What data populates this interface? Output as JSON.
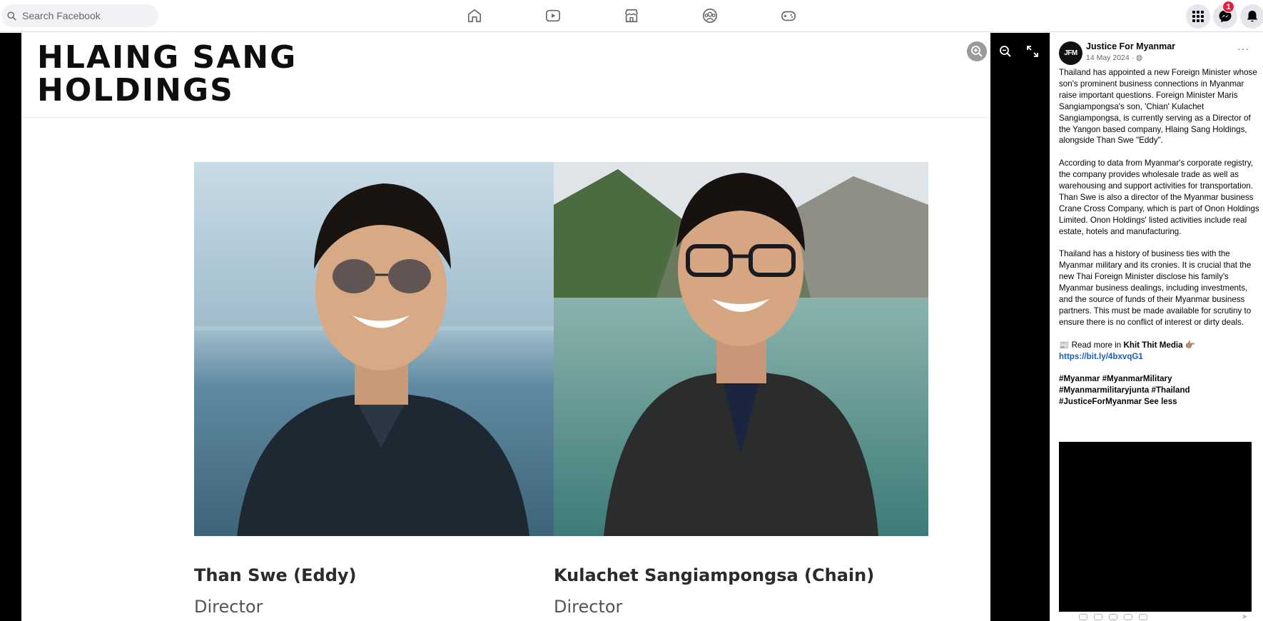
{
  "search": {
    "placeholder": "Search Facebook"
  },
  "nav": {
    "icons": [
      "home-icon",
      "video-icon",
      "marketplace-icon",
      "groups-icon",
      "gaming-icon"
    ]
  },
  "header_right": {
    "icons": [
      "menu-grid-icon",
      "messenger-icon",
      "notifications-icon"
    ],
    "messenger_badge": "1"
  },
  "viewer": {
    "controls": [
      "zoom-in-icon",
      "zoom-out-icon",
      "fullscreen-icon"
    ]
  },
  "image_content": {
    "title_line1": "HLAING SANG",
    "title_line2": "HOLDINGS",
    "people": [
      {
        "name": "Than Swe (Eddy)",
        "role": "Director"
      },
      {
        "name": "Kulachet Sangiampongsa (Chain)",
        "role": "Director"
      }
    ]
  },
  "post": {
    "avatar_text": "JFM",
    "author": "Justice For Myanmar",
    "date": "14 May 2024",
    "privacy_icon": "globe-icon",
    "more_label": "···",
    "paragraph1": "Thailand has appointed a new Foreign Minister whose son's prominent business connections in Myanmar raise important questions. Foreign Minister Maris Sangiampongsa's son, 'Chian' Kulachet Sangiampongsa, is currently serving as a Director of the Yangon based company, Hlaing Sang Holdings, alongside Than Swe \"Eddy\".",
    "paragraph2": "According to data from Myanmar's corporate registry, the company provides wholesale trade as well as warehousing and support activities for transportation. Than Swe is also a director of the Myanmar business Crane Cross Company, which is part of Onon Holdings Limited. Onon Holdings' listed activities include real estate, hotels and manufacturing.",
    "paragraph3": "Thailand has a history of business ties with the Myanmar military and its cronies. It is crucial that the new Thai Foreign Minister disclose his family's Myanmar business dealings, including investments, and the source of funds of their Myanmar business partners. This must be made available for scrutiny to ensure there is no conflict of interest or dirty deals.",
    "read_more_prefix": "📰 Read more in ",
    "read_more_source": "Khit Thit Media",
    "read_more_emoji": " 👉🏽",
    "link": "https://bit.ly/4bxvqG1",
    "hashtags_line1": "#Myanmar #MyanmarMilitary",
    "hashtags_line2": "#Myanmarmilitaryjunta #Thailand",
    "hashtags_line3": "#JusticeForMyanmar",
    "see_less": "See less"
  }
}
